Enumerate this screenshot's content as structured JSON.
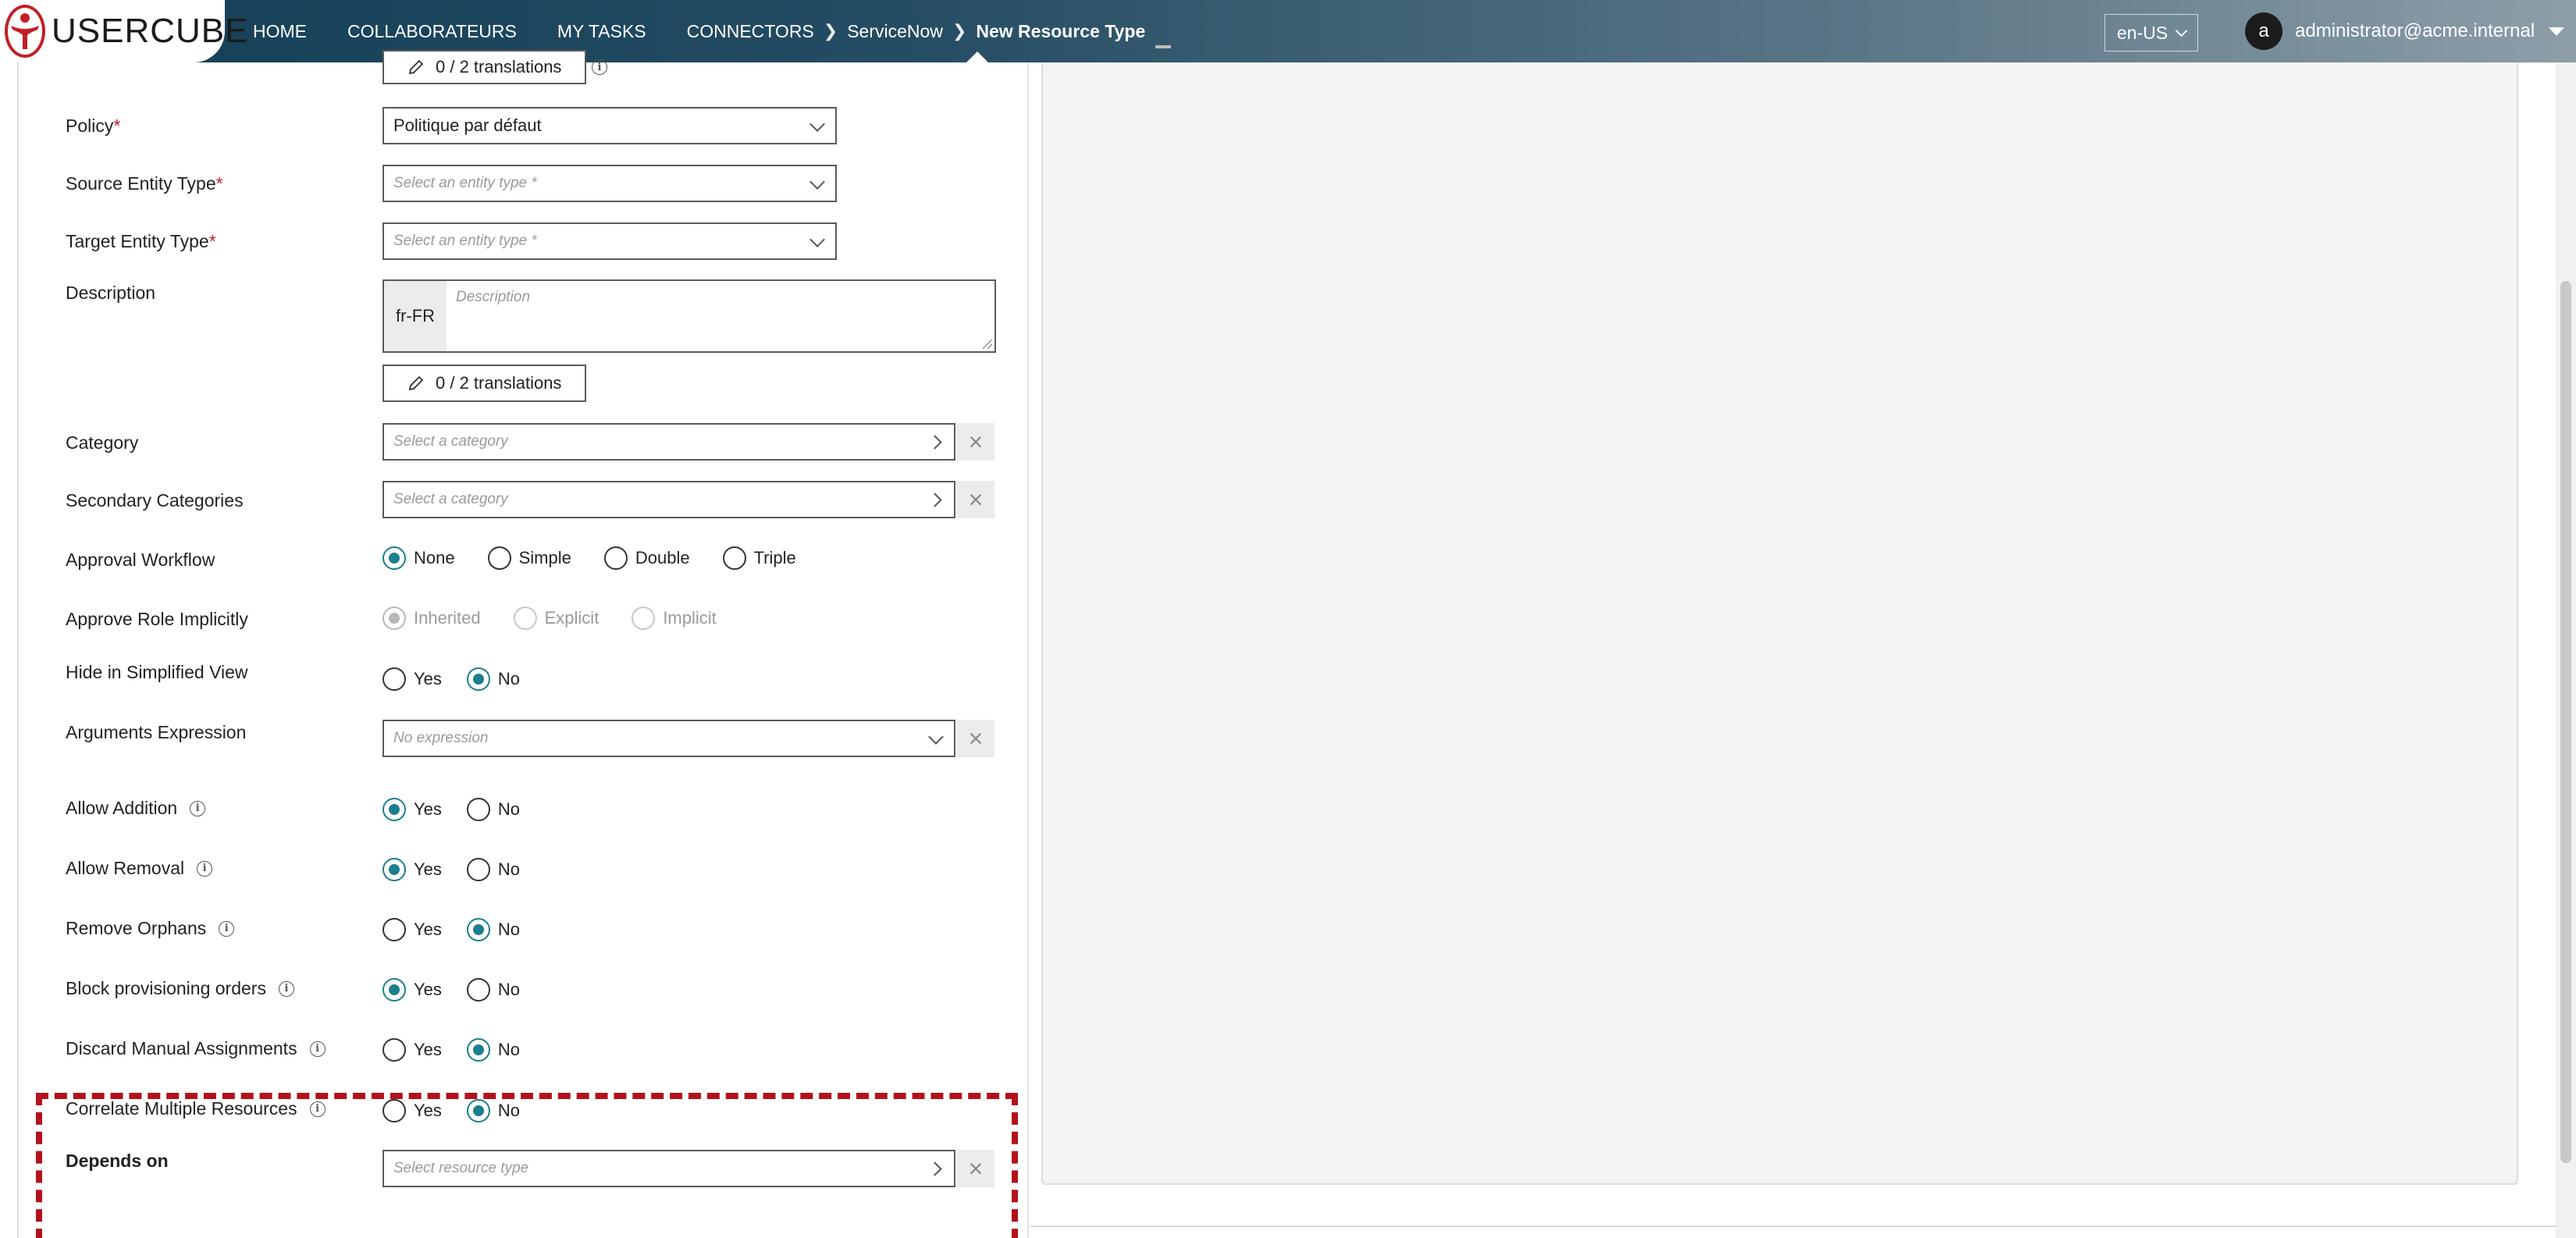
{
  "brand": {
    "logo_text": "USERCUBE"
  },
  "nav": {
    "items": [
      "HOME",
      "COLLABORATEURS",
      "MY TASKS"
    ],
    "breadcrumbs": [
      "CONNECTORS",
      "ServiceNow",
      "New Resource Type"
    ]
  },
  "header": {
    "language": "en-US",
    "user_initial": "a",
    "user_email": "administrator@acme.internal"
  },
  "form": {
    "top_translations": "0 / 2 translations",
    "policy": {
      "label": "Policy",
      "required": "*",
      "value": "Politique par défaut"
    },
    "source_entity_type": {
      "label": "Source Entity Type",
      "required": "*",
      "placeholder": "Select an entity type *"
    },
    "target_entity_type": {
      "label": "Target Entity Type",
      "required": "*",
      "placeholder": "Select an entity type *"
    },
    "description": {
      "label": "Description",
      "lang": "fr-FR",
      "placeholder": "Description",
      "translations": "0 / 2 translations"
    },
    "category": {
      "label": "Category",
      "placeholder": "Select a category"
    },
    "secondary_categories": {
      "label": "Secondary Categories",
      "placeholder": "Select a category"
    },
    "approval_workflow": {
      "label": "Approval Workflow",
      "options": [
        "None",
        "Simple",
        "Double",
        "Triple"
      ],
      "selected": "None"
    },
    "approve_role_implicitly": {
      "label": "Approve Role Implicitly",
      "options": [
        "Inherited",
        "Explicit",
        "Implicit"
      ],
      "selected": "Inherited",
      "disabled": true
    },
    "hide_in_simplified_view": {
      "label": "Hide in Simplified View",
      "options": [
        "Yes",
        "No"
      ],
      "selected": "No"
    },
    "arguments_expression": {
      "label": "Arguments Expression",
      "placeholder": "No expression"
    },
    "allow_addition": {
      "label": "Allow Addition",
      "options": [
        "Yes",
        "No"
      ],
      "selected": "Yes"
    },
    "allow_removal": {
      "label": "Allow Removal",
      "options": [
        "Yes",
        "No"
      ],
      "selected": "Yes"
    },
    "remove_orphans": {
      "label": "Remove Orphans",
      "options": [
        "Yes",
        "No"
      ],
      "selected": "No"
    },
    "block_provisioning_orders": {
      "label": "Block provisioning orders",
      "options": [
        "Yes",
        "No"
      ],
      "selected": "Yes"
    },
    "discard_manual_assignments": {
      "label": "Discard Manual Assignments",
      "options": [
        "Yes",
        "No"
      ],
      "selected": "No"
    },
    "correlate_multiple_resources": {
      "label": "Correlate Multiple Resources",
      "options": [
        "Yes",
        "No"
      ],
      "selected": "No"
    },
    "depends_on": {
      "label": "Depends on",
      "placeholder": "Select resource type"
    }
  },
  "colors": {
    "accent": "#1b7f8f",
    "required": "#c0202a",
    "highlight": "#b3121c",
    "navbar": "#1f4a60"
  }
}
